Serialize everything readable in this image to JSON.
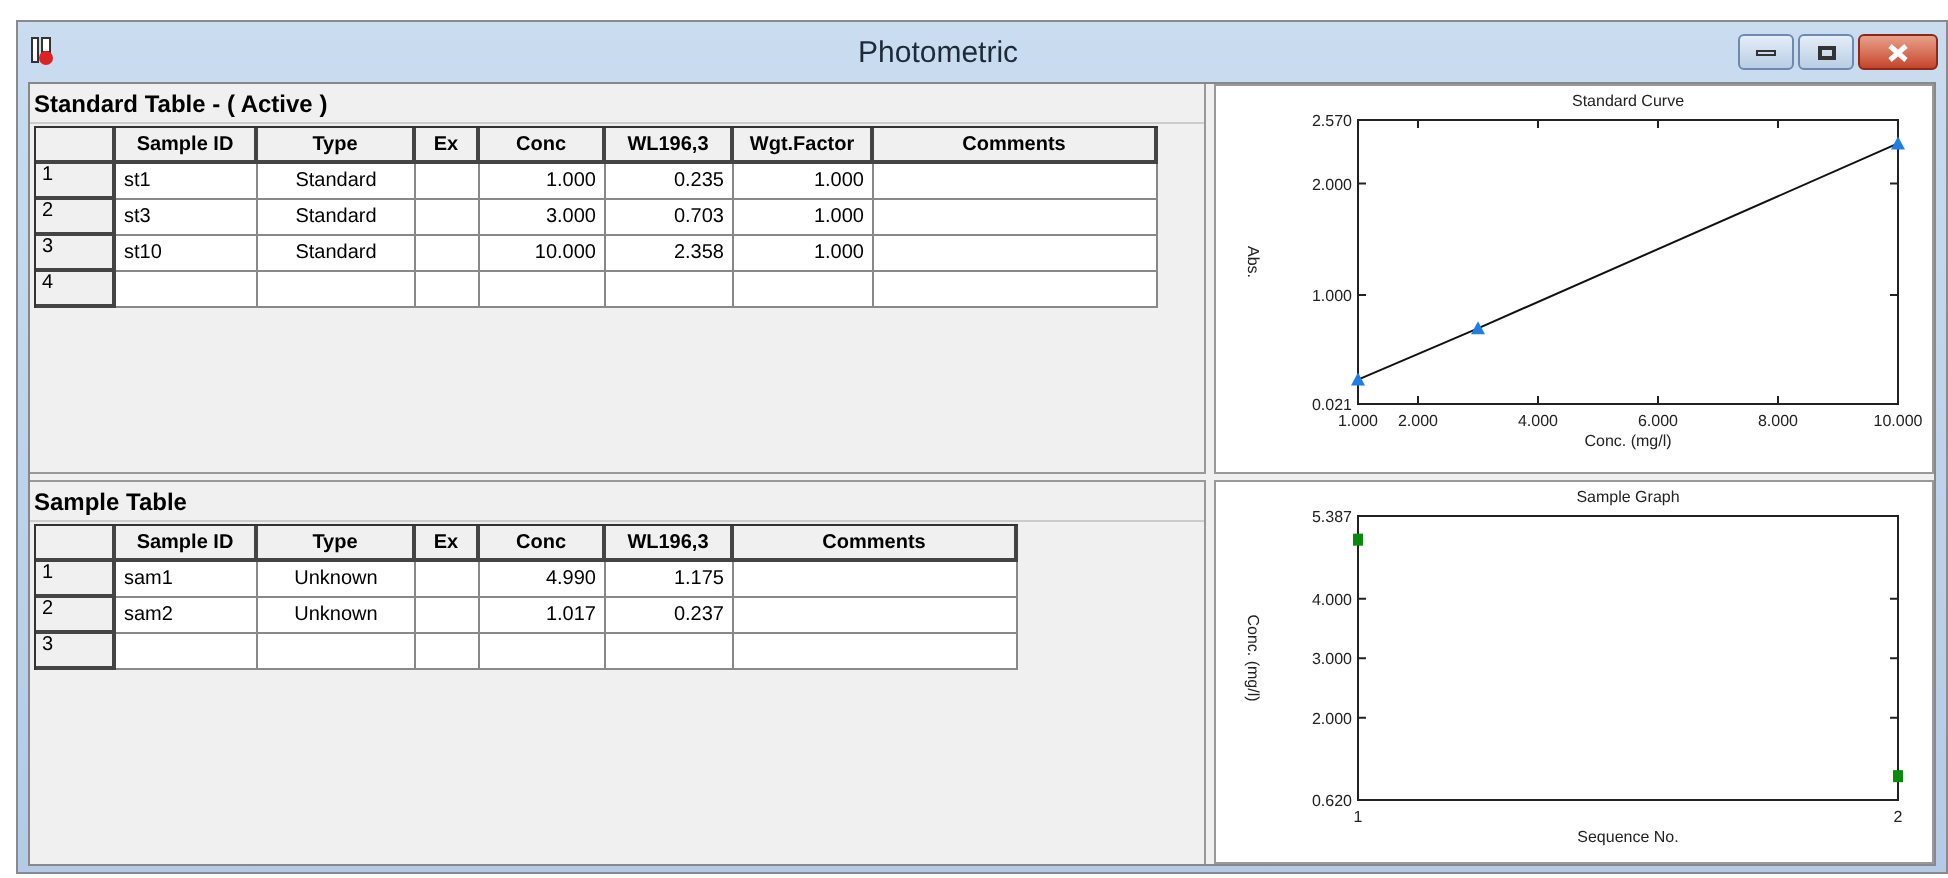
{
  "window": {
    "title": "Photometric"
  },
  "standard_table": {
    "title": "Standard Table - ( Active )",
    "columns": [
      {
        "label": "Sample ID",
        "kind": "text"
      },
      {
        "label": "Type",
        "kind": "center"
      },
      {
        "label": "Ex",
        "kind": "center"
      },
      {
        "label": "Conc",
        "kind": "number"
      },
      {
        "label": "WL196,3",
        "kind": "number"
      },
      {
        "label": "Wgt.Factor",
        "kind": "number"
      },
      {
        "label": "Comments",
        "kind": "text"
      }
    ],
    "rows": [
      {
        "number": "1",
        "cells": [
          "st1",
          "Standard",
          "",
          "1.000",
          "0.235",
          "1.000",
          ""
        ]
      },
      {
        "number": "2",
        "cells": [
          "st3",
          "Standard",
          "",
          "3.000",
          "0.703",
          "1.000",
          ""
        ]
      },
      {
        "number": "3",
        "cells": [
          "st10",
          "Standard",
          "",
          "10.000",
          "2.358",
          "1.000",
          ""
        ]
      },
      {
        "number": "4",
        "cells": [
          "",
          "",
          "",
          "",
          "",
          "",
          ""
        ]
      }
    ]
  },
  "standard_curve": {
    "chart_data": {
      "type": "line",
      "title": "Standard Curve",
      "xlabel": "Conc. (mg/l)",
      "ylabel": "Abs.",
      "x": [
        1,
        3,
        10
      ],
      "series": [
        {
          "color": "#1e7ee6",
          "marker": "triangle",
          "values": [
            0.24,
            0.7,
            2.36
          ]
        }
      ],
      "xlim": [
        1,
        10
      ],
      "ylim": [
        0.021,
        2.57
      ],
      "xticks": [
        {
          "value": 1,
          "label": "1.000"
        },
        {
          "value": 2,
          "label": "2.000"
        },
        {
          "value": 4,
          "label": "4.000"
        },
        {
          "value": 6,
          "label": "6.000"
        },
        {
          "value": 8,
          "label": "8.000"
        },
        {
          "value": 10,
          "label": "10.000"
        }
      ],
      "yticks": [
        {
          "value": 0.021,
          "label": "0.021"
        },
        {
          "value": 1,
          "label": "1.000"
        },
        {
          "value": 2,
          "label": "2.000"
        },
        {
          "value": 2.57,
          "label": "2.570"
        }
      ]
    }
  },
  "sample_table": {
    "title": "Sample Table",
    "columns": [
      {
        "label": "Sample ID",
        "kind": "text"
      },
      {
        "label": "Type",
        "kind": "center"
      },
      {
        "label": "Ex",
        "kind": "center"
      },
      {
        "label": "Conc",
        "kind": "number"
      },
      {
        "label": "WL196,3",
        "kind": "number"
      },
      {
        "label": "Comments",
        "kind": "text"
      }
    ],
    "rows": [
      {
        "number": "1",
        "cells": [
          "sam1",
          "Unknown",
          "",
          "4.990",
          "1.175",
          ""
        ]
      },
      {
        "number": "2",
        "cells": [
          "sam2",
          "Unknown",
          "",
          "1.017",
          "0.237",
          ""
        ]
      },
      {
        "number": "3",
        "cells": [
          "",
          "",
          "",
          "",
          "",
          ""
        ]
      }
    ]
  },
  "sample_graph": {
    "chart_data": {
      "type": "scatter",
      "title": "Sample Graph",
      "xlabel": "Sequence No.",
      "ylabel": "Conc. (mg/l)",
      "x": [
        1,
        2
      ],
      "series": [
        {
          "color": "#0a8a0a",
          "marker": "square",
          "values": [
            4.99,
            1.02
          ]
        }
      ],
      "xlim": [
        1,
        2
      ],
      "ylim": [
        0.62,
        5.387
      ],
      "xticks": [
        {
          "value": 1,
          "label": "1"
        },
        {
          "value": 2,
          "label": "2"
        }
      ],
      "yticks": [
        {
          "value": 0.62,
          "label": "0.620"
        },
        {
          "value": 2,
          "label": "2.000"
        },
        {
          "value": 3,
          "label": "3.000"
        },
        {
          "value": 4,
          "label": "4.000"
        },
        {
          "value": 5.387,
          "label": "5.387"
        }
      ]
    }
  }
}
